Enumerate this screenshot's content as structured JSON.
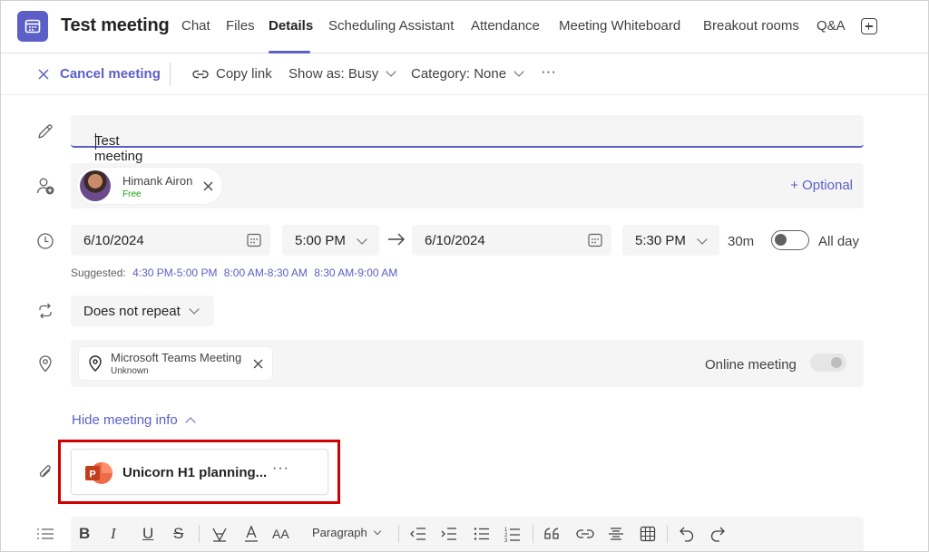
{
  "header": {
    "title": "Test meeting",
    "tabs": [
      {
        "label": "Chat",
        "active": false
      },
      {
        "label": "Files",
        "active": false
      },
      {
        "label": "Details",
        "active": true
      },
      {
        "label": "Scheduling Assistant",
        "active": false
      },
      {
        "label": "Attendance",
        "active": false
      },
      {
        "label": "Meeting Whiteboard",
        "active": false
      },
      {
        "label": "Breakout rooms",
        "active": false
      },
      {
        "label": "Q&A",
        "active": false
      }
    ]
  },
  "toolbar": {
    "cancel_label": "Cancel meeting",
    "copy_link_label": "Copy link",
    "show_as_label": "Show as: Busy",
    "category_label": "Category: None",
    "more_label": "···"
  },
  "form": {
    "title_value": "Test meeting",
    "attendee": {
      "name": "Himank Airon",
      "status": "Free"
    },
    "optional_label": "+ Optional",
    "start_date": "6/10/2024",
    "start_time": "5:00 PM",
    "end_date": "6/10/2024",
    "end_time": "5:30 PM",
    "duration": "30m",
    "all_day_label": "All day",
    "all_day_on": false,
    "suggested_label": "Suggested:",
    "suggestions": [
      "4:30 PM-5:00 PM",
      "8:00 AM-8:30 AM",
      "8:30 AM-9:00 AM"
    ],
    "repeat_value": "Does not repeat",
    "location": {
      "name": "Microsoft Teams Meeting",
      "sub": "Unknown"
    },
    "online_meeting_label": "Online meeting",
    "online_meeting_on": false,
    "hide_info_label": "Hide meeting info",
    "attachment": {
      "name": "Unicorn H1 planning...",
      "more": "···"
    }
  },
  "editor": {
    "paragraph_label": "Paragraph",
    "bold": "B",
    "italic": "I",
    "underline": "U",
    "strike": "S",
    "font_size": "AA"
  },
  "colors": {
    "accent": "#5b5fc7",
    "highlight": "#d00000",
    "status_free": "#13a10e",
    "powerpoint": "#c43e1c"
  }
}
